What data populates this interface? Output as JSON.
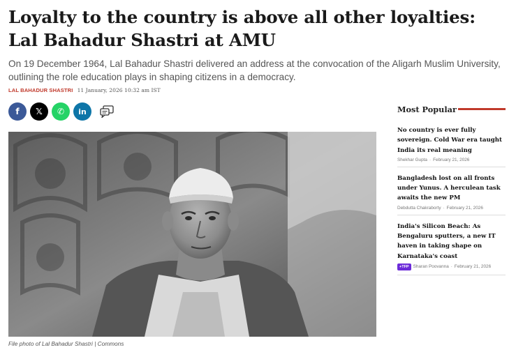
{
  "article": {
    "headline": "Loyalty to the country is above all other loyalties: Lal Bahadur Shastri at AMU",
    "dek": "On 19 December 1964, Lal Bahadur Shastri delivered an address at the convocation of the Aligarh Muslim University, outlining the role education plays in shaping citizens in a democracy.",
    "author": "LAL BAHADUR SHASTRI",
    "date": "11 January, 2026 10:32 am IST",
    "caption": "File photo of Lal Bahadur Shastri | Commons"
  },
  "share": {
    "facebook": "f",
    "x": "𝕏",
    "whatsapp": "✆",
    "linkedin": "in"
  },
  "sidebar": {
    "title": "Most Popular",
    "items": [
      {
        "title": "No country is ever fully sovereign. Cold War era taught India its real meaning",
        "author": "Shekhar Gupta",
        "sep": "·",
        "date": "February 21, 2026",
        "badge": ""
      },
      {
        "title": "Bangladesh lost on all fronts under Yunus. A herculean task awaits the new PM",
        "author": "Debdutta Chakraborty",
        "sep": "·",
        "date": "February 21, 2026",
        "badge": ""
      },
      {
        "title": "India's Silicon Beach: As Bengaluru sputters, a new IT haven in taking shape on Karnataka's coast",
        "author": "Sharan Poovanna",
        "sep": "·",
        "date": "February 21, 2026",
        "badge": "+TFP"
      }
    ]
  },
  "colors": {
    "accent": "#c0392b",
    "facebook": "#3b5998",
    "whatsapp": "#25d366",
    "linkedin": "#0e76a8",
    "badge": "#6c2bd9"
  }
}
